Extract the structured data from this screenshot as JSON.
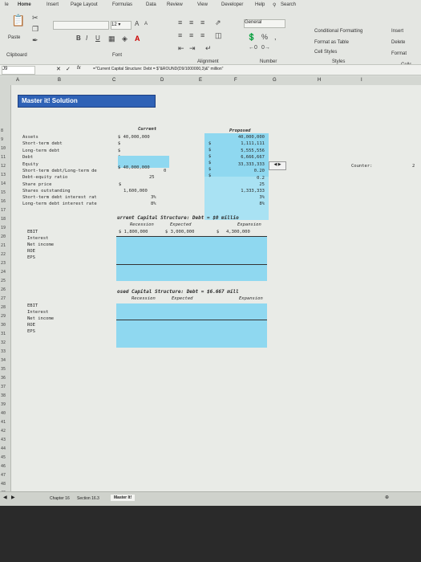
{
  "ribbon": {
    "tabs": [
      "Home",
      "Insert",
      "Page Layout",
      "Formulas",
      "Data",
      "Review",
      "View",
      "Developer",
      "Help"
    ],
    "search": "Search",
    "font_size": "12",
    "number_format": "General",
    "percent": "%",
    "comma": ",",
    "conditional_formatting": "Conditional Formatting",
    "format_as_table": "Format as Table",
    "cell_styles": "Cell Styles",
    "insert": "Insert",
    "delete": "Delete",
    "format": "Format",
    "groups": {
      "clipboard": "Clipboard",
      "font": "Font",
      "alignment": "Alignment",
      "number": "Number",
      "styles": "Styles",
      "cells": "Cells"
    },
    "paste": "Paste",
    "bold": "B",
    "italic": "I",
    "underline": "U",
    "font_color": "A",
    "grow_font": "A",
    "shrink_font": "A"
  },
  "formula_bar": {
    "cell_ref": "J9",
    "fx": "fx",
    "formula": "=\"Current Capital Structure: Debt = $\"&ROUND(D9/1000000,3)&\" million\""
  },
  "columns": [
    "A",
    "B",
    "C",
    "D",
    "E",
    "F",
    "G",
    "H",
    "I"
  ],
  "rows": [
    "8",
    "9",
    "10",
    "11",
    "12",
    "13",
    "14",
    "15",
    "16",
    "17",
    "18",
    "19",
    "20",
    "21",
    "22",
    "23",
    "24",
    "25",
    "26",
    "27",
    "28",
    "29",
    "30",
    "31",
    "32",
    "33",
    "34",
    "35",
    "36",
    "37",
    "38",
    "39",
    "40",
    "41",
    "42",
    "43",
    "44",
    "45",
    "46",
    "47",
    "48",
    "49",
    "50",
    "51",
    "52",
    "53"
  ],
  "sheet": {
    "banner": "Master it! Solution",
    "current_hdr": "Current",
    "proposed_hdr": "Proposed",
    "labels": [
      "Assets",
      "Short-term debt",
      "Long-term debt",
      "Debt",
      "Equity",
      "Short-term debt/Long-term de",
      "Debt-equity ratio",
      "Share price",
      "Shares outstanding",
      "Short-term debt interest rat",
      "Long-term debt interest rate"
    ],
    "current": [
      "$ 40,000,000",
      "$",
      "$",
      "$",
      "$ 40,000,000",
      "0",
      "$",
      "1,600,000",
      "3%",
      "8%"
    ],
    "current_extra": "25",
    "proposed_dollar": [
      "$",
      "$",
      "$",
      "$",
      "$",
      "$"
    ],
    "proposed": [
      "40,000,000",
      "1,111,111",
      "5,555,556",
      "6,666,667",
      "33,333,333",
      "0.20",
      "0.2",
      "25",
      "1,333,333",
      "3%",
      "8%"
    ],
    "spinner": "◀ ▶",
    "counter": "Counter:",
    "counter_val": "2",
    "cur_title": "urrent Capital Structure: Debt = $0 millio",
    "cur_cols": [
      "Recession",
      "Expected",
      "Expansion"
    ],
    "cur_ebit": [
      "$  1,800,000",
      "$ 3,000,000",
      "$",
      "4,300,000"
    ],
    "block1": [
      "EBIT",
      "Interest",
      "Net income",
      "ROE",
      "EPS"
    ],
    "prop_title": "osed Capital Structure: Debt = $6.667 mill",
    "prop_cols": [
      "Recession",
      "Expected",
      "Expansion"
    ],
    "block2": [
      "EBIT",
      "Interest",
      "Net income",
      "ROE",
      "EPS"
    ]
  },
  "sheettabs": [
    "Chapter 16",
    "Section 16.3",
    "Master It!"
  ]
}
